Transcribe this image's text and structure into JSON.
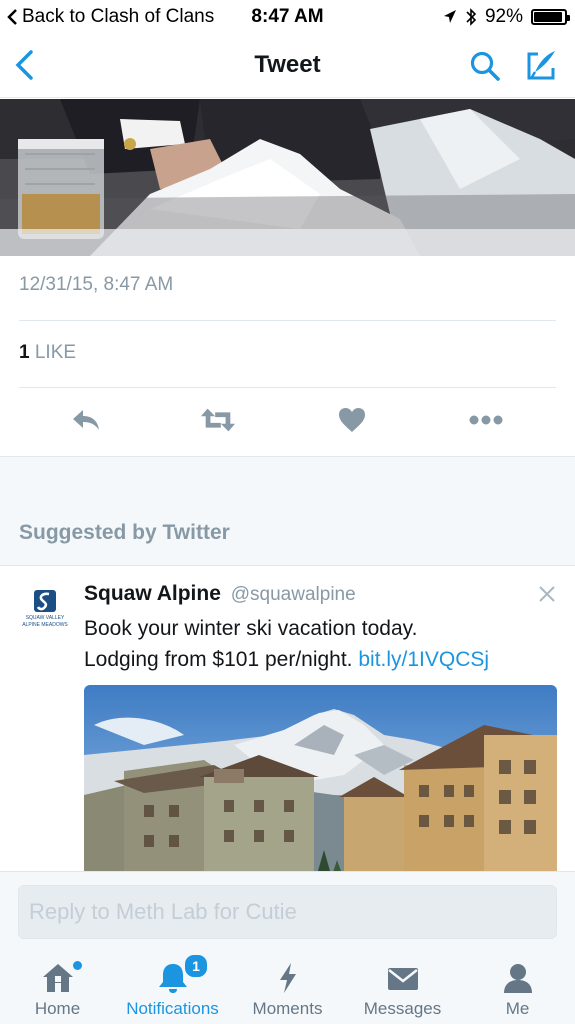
{
  "status_bar": {
    "back_app": "Back to Clash of Clans",
    "time": "8:47 AM",
    "battery": "92%",
    "battery_level": 0.92
  },
  "nav": {
    "title": "Tweet"
  },
  "tweet": {
    "timestamp": "12/31/15, 8:47 AM",
    "likes_count": "1",
    "likes_label": "LIKE"
  },
  "suggested": {
    "section_label": "Suggested by Twitter",
    "author_name": "Squaw Alpine",
    "author_handle": "@squawalpine",
    "avatar_text_line1": "SQUAW VALLEY",
    "avatar_text_line2": "ALPINE MEADOWS",
    "text_line1": "Book your winter ski vacation today.",
    "text_line2_prefix": "Lodging from $101 per/night. ",
    "link": "bit.ly/1IVQCSj"
  },
  "reply": {
    "placeholder": "Reply to Meth Lab for Cutie"
  },
  "tabs": [
    {
      "label": "Home",
      "icon": "home-icon"
    },
    {
      "label": "Notifications",
      "icon": "bell-icon",
      "badge": "1"
    },
    {
      "label": "Moments",
      "icon": "lightning-icon"
    },
    {
      "label": "Messages",
      "icon": "envelope-icon"
    },
    {
      "label": "Me",
      "icon": "person-icon"
    }
  ],
  "colors": {
    "accent": "#1b95e0",
    "muted": "#8899a6",
    "action_icon": "#8899a6",
    "background_gray": "#f5f8fa"
  }
}
